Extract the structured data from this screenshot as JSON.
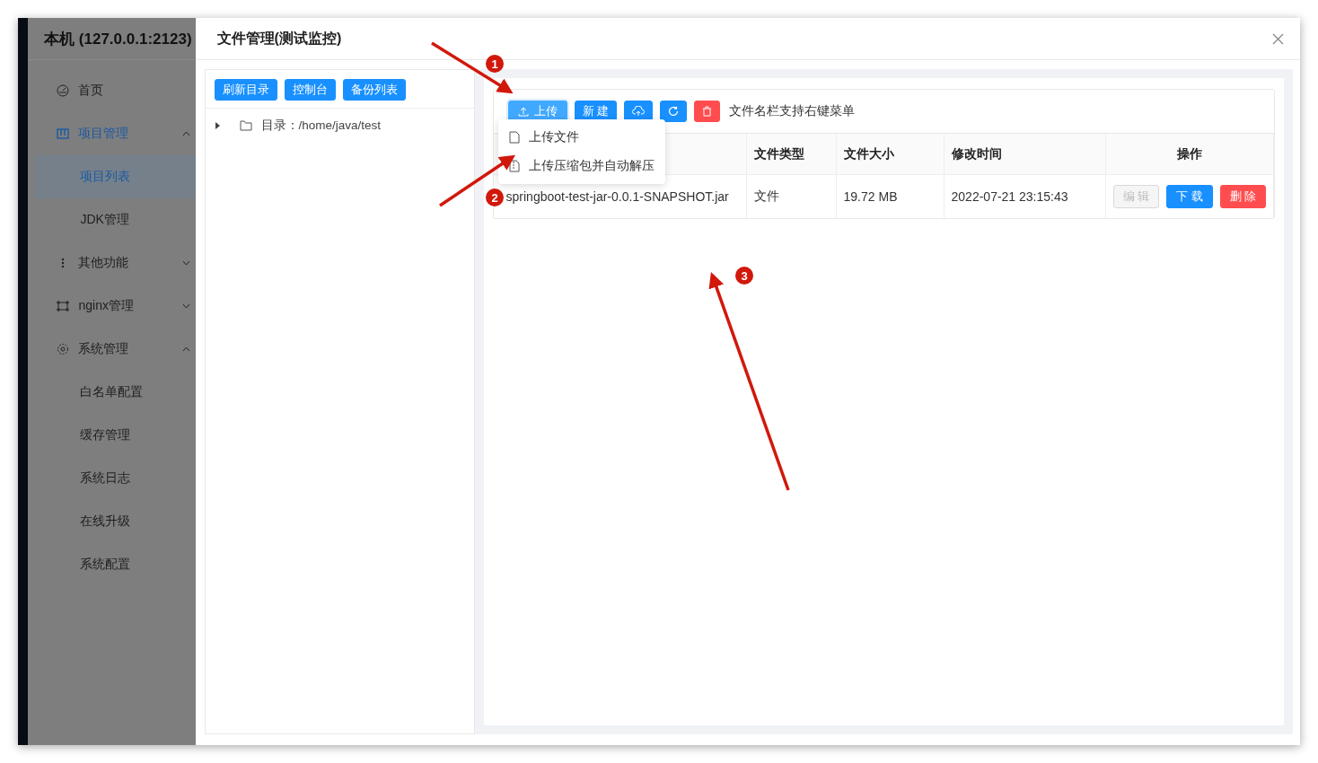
{
  "sidebar": {
    "title": "本机 (127.0.0.1:2123)",
    "items": [
      {
        "label": "首页",
        "selected": false
      },
      {
        "label": "项目管理",
        "selected": true,
        "expanded": true,
        "children": [
          {
            "label": "项目列表",
            "selected": true
          },
          {
            "label": "JDK管理",
            "selected": false
          }
        ]
      },
      {
        "label": "其他功能",
        "selected": false,
        "expanded": false
      },
      {
        "label": "nginx管理",
        "selected": false,
        "expanded": false
      },
      {
        "label": "系统管理",
        "selected": false,
        "expanded": true,
        "children": [
          {
            "label": "白名单配置",
            "selected": false
          },
          {
            "label": "缓存管理",
            "selected": false
          },
          {
            "label": "系统日志",
            "selected": false
          },
          {
            "label": "在线升级",
            "selected": false
          },
          {
            "label": "系统配置",
            "selected": false
          }
        ]
      }
    ]
  },
  "dialog": {
    "title": "文件管理(测试监控)",
    "left_panel": {
      "buttons": [
        "刷新目录",
        "控制台",
        "备份列表"
      ],
      "tree": [
        {
          "label": "目录：/home/java/test",
          "expanded": false
        }
      ]
    },
    "toolbar": {
      "buttons": [
        {
          "kind": "labeled",
          "label": "上传",
          "color": "#40a9ff",
          "hovered": true
        },
        {
          "kind": "text",
          "label": "新 建",
          "color": "#1890ff",
          "hovered": false
        },
        {
          "kind": "icon",
          "color": "#1890ff",
          "hovered": false
        },
        {
          "kind": "icon",
          "color": "#1890ff",
          "hovered": false
        },
        {
          "kind": "icon",
          "color": "#ff4d4f",
          "hovered": false
        }
      ],
      "hint": "文件名栏支持右键菜单"
    },
    "upload_menu": [
      "上传文件",
      "上传压缩包并自动解压"
    ],
    "table": {
      "columns": [
        "",
        "文件类型",
        "文件大小",
        "修改时间",
        "操作"
      ],
      "rows": [
        {
          "cells": [
            "springboot-test-jar-0.0.1-SNAPSHOT.jar",
            "文件",
            "19.72 MB",
            "2022-07-21 23:15:43"
          ],
          "actions": [
            {
              "label": "编 辑",
              "color": "#f5f5f5",
              "disabled": true
            },
            {
              "label": "下 载",
              "color": "#1890ff",
              "disabled": false
            },
            {
              "label": "删 除",
              "color": "#ff4d4f",
              "disabled": false
            }
          ]
        }
      ]
    }
  },
  "annotations": [
    "1",
    "2",
    "3"
  ]
}
